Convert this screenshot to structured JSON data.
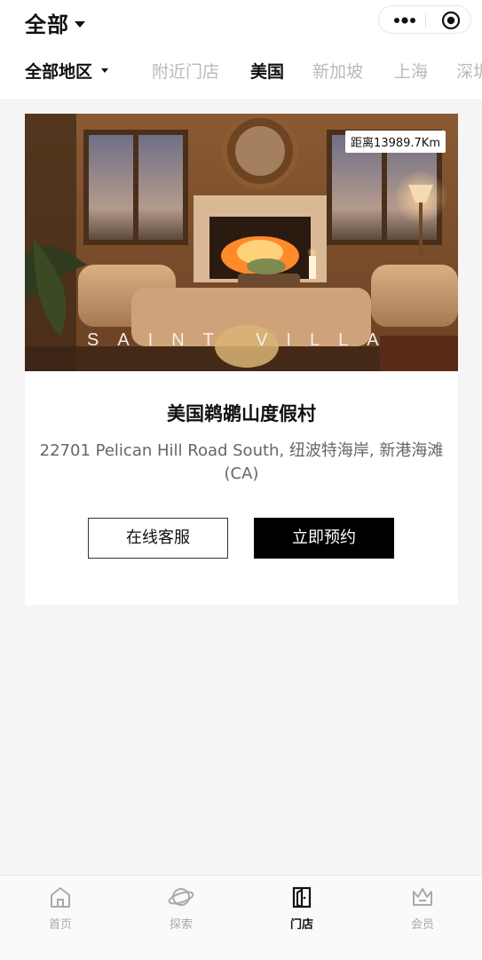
{
  "header": {
    "title": "全部"
  },
  "capsule": {
    "more_icon": "more-dots-icon",
    "close_icon": "target-circle-icon"
  },
  "filters": {
    "region_label": "全部地区",
    "tabs": [
      "附近门店",
      "美国",
      "新加坡",
      "上海",
      "深圳"
    ],
    "active_tab": "美国"
  },
  "store": {
    "distance": "距离13989.7Km",
    "hero_overlay": "SAINT VILLA",
    "name": "美国鹈鹕山度假村",
    "address": "22701 Pelican Hill Road South, 纽波特海岸, 新港海滩(CA)",
    "service_button": "在线客服",
    "book_button": "立即预约"
  },
  "bottom_nav": {
    "items": [
      {
        "label": "首页",
        "icon": "home-icon"
      },
      {
        "label": "探索",
        "icon": "planet-icon"
      },
      {
        "label": "门店",
        "icon": "door-icon"
      },
      {
        "label": "会员",
        "icon": "crown-icon"
      }
    ],
    "active": "门店"
  },
  "colors": {
    "accent": "#000000",
    "background": "#f5f5f5",
    "inactive_tab": "#b9b9b9"
  }
}
